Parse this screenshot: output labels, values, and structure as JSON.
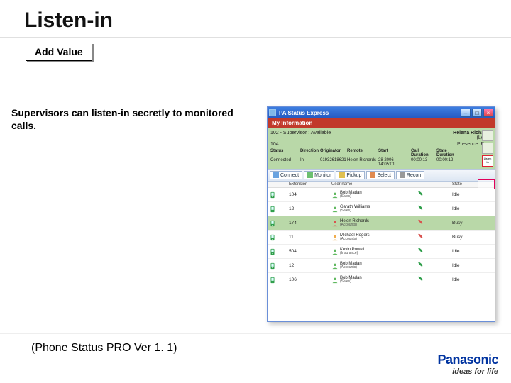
{
  "slide": {
    "title": "Listen-in",
    "badge": "Add Value",
    "body": "Supervisors can listen-in secretly to monitored calls.",
    "version": "(Phone Status PRO Ver 1. 1)"
  },
  "brand": {
    "name": "Panasonic",
    "tagline": "ideas for life"
  },
  "app": {
    "title": "PA Status Express",
    "section_label": "My Information",
    "supervisor_line": "102 - Supervisor : Available",
    "user_name": "Helena Richards",
    "user_status": "(Local)",
    "info": {
      "ext_label": "104",
      "presence_label": "Presence:",
      "presence_value": "Busy"
    },
    "grid_headers": [
      "Status",
      "Direction",
      "Originator",
      "Remote",
      "Start",
      "Call Duration",
      "State Duration"
    ],
    "grid_row": [
      "Connected",
      "In",
      "01932618621",
      "Helen Richards",
      "28 2006 14:05:01",
      "00:00:13",
      "00:00:12"
    ],
    "listenin_btn": "Listen In",
    "toolbar": [
      {
        "label": "Connect",
        "icon": "b"
      },
      {
        "label": "Monitor",
        "icon": "g"
      },
      {
        "label": "Pickup",
        "icon": "y"
      },
      {
        "label": "Select",
        "icon": "o"
      },
      {
        "label": "Recon",
        "icon": "gr"
      }
    ],
    "list_headers": [
      "",
      "Extension",
      "User name",
      "",
      "State"
    ],
    "rows": [
      {
        "ext": "104",
        "name": "Bob Madan",
        "dept": "(Sales)",
        "state": "Idle",
        "person": "green",
        "busy": false,
        "sel": false
      },
      {
        "ext": "12",
        "name": "Garath Williams",
        "dept": "(Sales)",
        "state": "Idle",
        "person": "green",
        "busy": false,
        "sel": false
      },
      {
        "ext": "174",
        "name": "Helen Richards",
        "dept": "(Accounts)",
        "state": "Busy",
        "person": "red",
        "busy": true,
        "sel": true
      },
      {
        "ext": "11",
        "name": "Michael Rogers",
        "dept": "(Accounts)",
        "state": "Busy",
        "person": "orange",
        "busy": true,
        "sel": false
      },
      {
        "ext": "504",
        "name": "Kevin Powell",
        "dept": "(Insurance)",
        "state": "Idle",
        "person": "green",
        "busy": false,
        "sel": false
      },
      {
        "ext": "12",
        "name": "Bob Madan",
        "dept": "(Accounts)",
        "state": "Idle",
        "person": "green",
        "busy": false,
        "sel": false
      },
      {
        "ext": "106",
        "name": "Bob Madan",
        "dept": "(Sales)",
        "state": "Idle",
        "person": "green",
        "busy": false,
        "sel": false
      }
    ]
  }
}
